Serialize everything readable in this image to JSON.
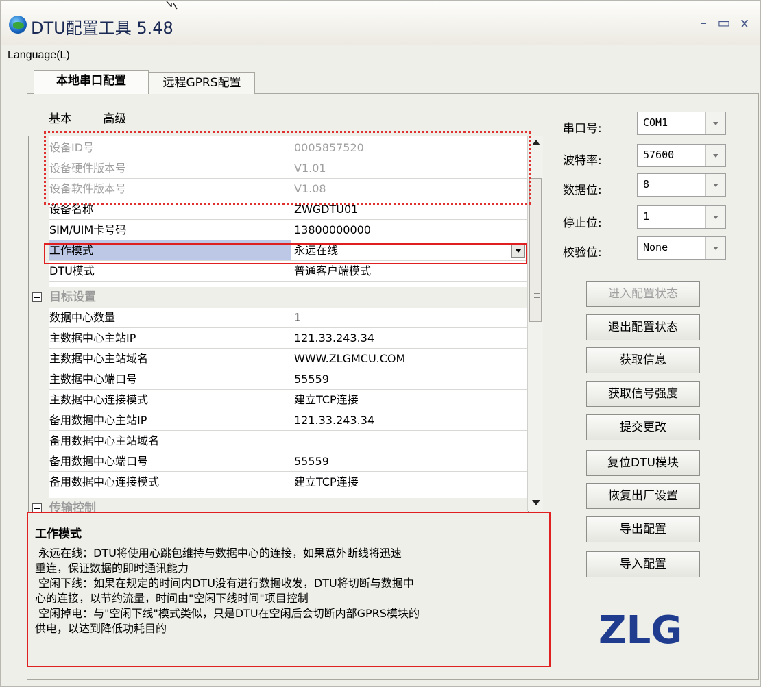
{
  "window": {
    "title": "DTU配置工具 5.48",
    "min_glyph": "–",
    "max_glyph": "▭",
    "close_glyph": "x"
  },
  "menu": {
    "language": "Language(L)"
  },
  "tabs": [
    {
      "label": "本地串口配置",
      "active": true
    },
    {
      "label": "远程GPRS配置",
      "active": false
    }
  ],
  "subtabs": {
    "basic": "基本",
    "advanced": "高级"
  },
  "grid": {
    "rows": [
      {
        "key": "设备ID号",
        "value": "0005857520",
        "readonly": true
      },
      {
        "key": "设备硬件版本号",
        "value": "V1.01",
        "readonly": true
      },
      {
        "key": "设备软件版本号",
        "value": "V1.08",
        "readonly": true
      },
      {
        "key": "设备名称",
        "value": "ZWGDTU01"
      },
      {
        "key": "SIM/UIM卡号码",
        "value": "13800000000"
      },
      {
        "key": "工作模式",
        "value": "永远在线",
        "selected": true
      },
      {
        "key": "DTU模式",
        "value": "普通客户端模式"
      }
    ],
    "category1": "目标设置",
    "rows2": [
      {
        "key": "数据中心数量",
        "value": "1"
      },
      {
        "key": "主数据中心主站IP",
        "value": "121.33.243.34"
      },
      {
        "key": "主数据中心主站域名",
        "value": "WWW.ZLGMCU.COM"
      },
      {
        "key": "主数据中心端口号",
        "value": "55559"
      },
      {
        "key": "主数据中心连接模式",
        "value": "建立TCP连接"
      },
      {
        "key": "备用数据中心主站IP",
        "value": "121.33.243.34"
      },
      {
        "key": "备用数据中心主站域名",
        "value": ""
      },
      {
        "key": "备用数据中心端口号",
        "value": "55559"
      },
      {
        "key": "备用数据中心连接模式",
        "value": "建立TCP连接"
      }
    ],
    "category2": "传输控制"
  },
  "description": {
    "title": "工作模式",
    "body": " 永远在线：DTU将使用心跳包维持与数据中心的连接，如果意外断线将迅速\n重连，保证数据的即时通讯能力\n 空闲下线：如果在规定的时间内DTU没有进行数据收发，DTU将切断与数据中\n心的连接，以节约流量，时间由\"空闲下线时间\"项目控制\n 空闲掉电：与\"空闲下线\"模式类似，只是DTU在空闲后会切断内部GPRS模块的\n供电，以达到降低功耗目的"
  },
  "serial": {
    "port": {
      "label": "串口号:",
      "value": "COM1"
    },
    "baud": {
      "label": "波特率:",
      "value": "57600"
    },
    "databits": {
      "label": "数据位:",
      "value": "8"
    },
    "stopbits": {
      "label": "停止位:",
      "value": "1"
    },
    "parity": {
      "label": "校验位:",
      "value": "None"
    }
  },
  "buttons": {
    "enter_config": "进入配置状态",
    "exit_config": "退出配置状态",
    "get_info": "获取信息",
    "get_signal": "获取信号强度",
    "submit": "提交更改",
    "reset_dtu": "复位DTU模块",
    "factory_reset": "恢复出厂设置",
    "export": "导出配置",
    "import": "导入配置"
  },
  "logo": {
    "text": "ZLG",
    "color": "#1f3c8f"
  },
  "colors": {
    "selection": "#bcc8e6",
    "highlight_red": "#e02020"
  }
}
